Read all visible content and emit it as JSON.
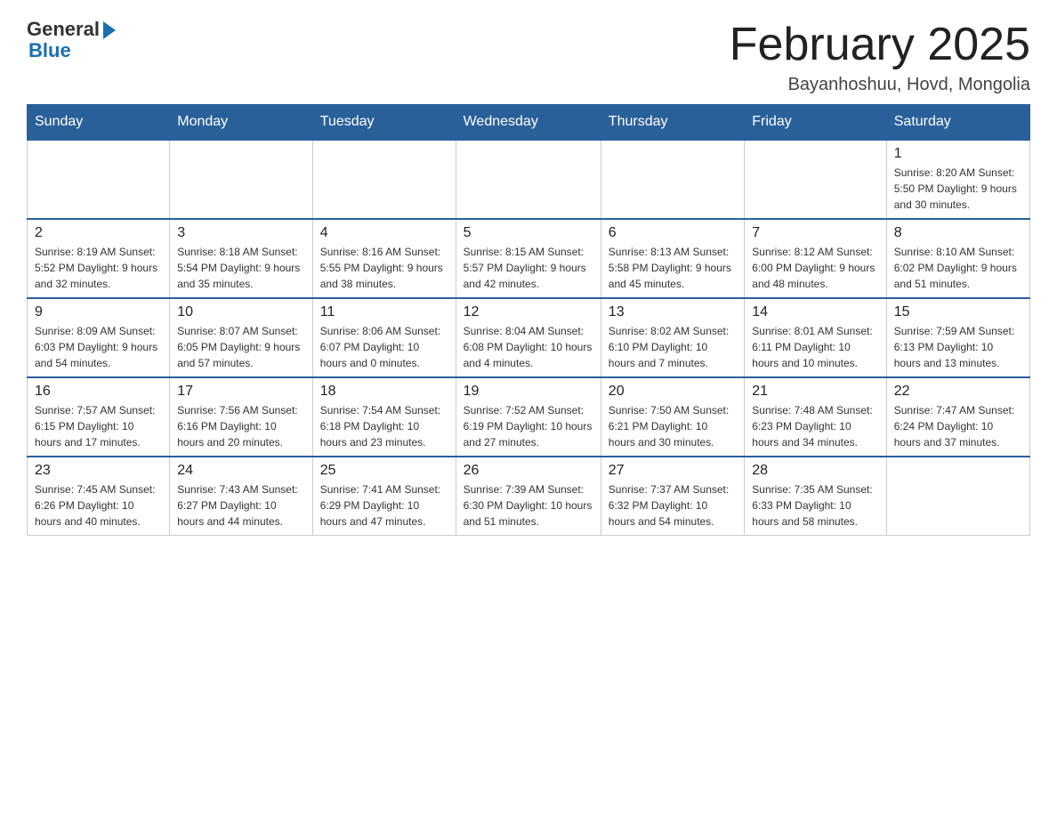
{
  "logo": {
    "general": "General",
    "blue": "Blue"
  },
  "title": {
    "month": "February 2025",
    "location": "Bayanhoshuu, Hovd, Mongolia"
  },
  "weekdays": [
    "Sunday",
    "Monday",
    "Tuesday",
    "Wednesday",
    "Thursday",
    "Friday",
    "Saturday"
  ],
  "weeks": [
    [
      {
        "day": "",
        "info": ""
      },
      {
        "day": "",
        "info": ""
      },
      {
        "day": "",
        "info": ""
      },
      {
        "day": "",
        "info": ""
      },
      {
        "day": "",
        "info": ""
      },
      {
        "day": "",
        "info": ""
      },
      {
        "day": "1",
        "info": "Sunrise: 8:20 AM\nSunset: 5:50 PM\nDaylight: 9 hours and 30 minutes."
      }
    ],
    [
      {
        "day": "2",
        "info": "Sunrise: 8:19 AM\nSunset: 5:52 PM\nDaylight: 9 hours and 32 minutes."
      },
      {
        "day": "3",
        "info": "Sunrise: 8:18 AM\nSunset: 5:54 PM\nDaylight: 9 hours and 35 minutes."
      },
      {
        "day": "4",
        "info": "Sunrise: 8:16 AM\nSunset: 5:55 PM\nDaylight: 9 hours and 38 minutes."
      },
      {
        "day": "5",
        "info": "Sunrise: 8:15 AM\nSunset: 5:57 PM\nDaylight: 9 hours and 42 minutes."
      },
      {
        "day": "6",
        "info": "Sunrise: 8:13 AM\nSunset: 5:58 PM\nDaylight: 9 hours and 45 minutes."
      },
      {
        "day": "7",
        "info": "Sunrise: 8:12 AM\nSunset: 6:00 PM\nDaylight: 9 hours and 48 minutes."
      },
      {
        "day": "8",
        "info": "Sunrise: 8:10 AM\nSunset: 6:02 PM\nDaylight: 9 hours and 51 minutes."
      }
    ],
    [
      {
        "day": "9",
        "info": "Sunrise: 8:09 AM\nSunset: 6:03 PM\nDaylight: 9 hours and 54 minutes."
      },
      {
        "day": "10",
        "info": "Sunrise: 8:07 AM\nSunset: 6:05 PM\nDaylight: 9 hours and 57 minutes."
      },
      {
        "day": "11",
        "info": "Sunrise: 8:06 AM\nSunset: 6:07 PM\nDaylight: 10 hours and 0 minutes."
      },
      {
        "day": "12",
        "info": "Sunrise: 8:04 AM\nSunset: 6:08 PM\nDaylight: 10 hours and 4 minutes."
      },
      {
        "day": "13",
        "info": "Sunrise: 8:02 AM\nSunset: 6:10 PM\nDaylight: 10 hours and 7 minutes."
      },
      {
        "day": "14",
        "info": "Sunrise: 8:01 AM\nSunset: 6:11 PM\nDaylight: 10 hours and 10 minutes."
      },
      {
        "day": "15",
        "info": "Sunrise: 7:59 AM\nSunset: 6:13 PM\nDaylight: 10 hours and 13 minutes."
      }
    ],
    [
      {
        "day": "16",
        "info": "Sunrise: 7:57 AM\nSunset: 6:15 PM\nDaylight: 10 hours and 17 minutes."
      },
      {
        "day": "17",
        "info": "Sunrise: 7:56 AM\nSunset: 6:16 PM\nDaylight: 10 hours and 20 minutes."
      },
      {
        "day": "18",
        "info": "Sunrise: 7:54 AM\nSunset: 6:18 PM\nDaylight: 10 hours and 23 minutes."
      },
      {
        "day": "19",
        "info": "Sunrise: 7:52 AM\nSunset: 6:19 PM\nDaylight: 10 hours and 27 minutes."
      },
      {
        "day": "20",
        "info": "Sunrise: 7:50 AM\nSunset: 6:21 PM\nDaylight: 10 hours and 30 minutes."
      },
      {
        "day": "21",
        "info": "Sunrise: 7:48 AM\nSunset: 6:23 PM\nDaylight: 10 hours and 34 minutes."
      },
      {
        "day": "22",
        "info": "Sunrise: 7:47 AM\nSunset: 6:24 PM\nDaylight: 10 hours and 37 minutes."
      }
    ],
    [
      {
        "day": "23",
        "info": "Sunrise: 7:45 AM\nSunset: 6:26 PM\nDaylight: 10 hours and 40 minutes."
      },
      {
        "day": "24",
        "info": "Sunrise: 7:43 AM\nSunset: 6:27 PM\nDaylight: 10 hours and 44 minutes."
      },
      {
        "day": "25",
        "info": "Sunrise: 7:41 AM\nSunset: 6:29 PM\nDaylight: 10 hours and 47 minutes."
      },
      {
        "day": "26",
        "info": "Sunrise: 7:39 AM\nSunset: 6:30 PM\nDaylight: 10 hours and 51 minutes."
      },
      {
        "day": "27",
        "info": "Sunrise: 7:37 AM\nSunset: 6:32 PM\nDaylight: 10 hours and 54 minutes."
      },
      {
        "day": "28",
        "info": "Sunrise: 7:35 AM\nSunset: 6:33 PM\nDaylight: 10 hours and 58 minutes."
      },
      {
        "day": "",
        "info": ""
      }
    ]
  ]
}
